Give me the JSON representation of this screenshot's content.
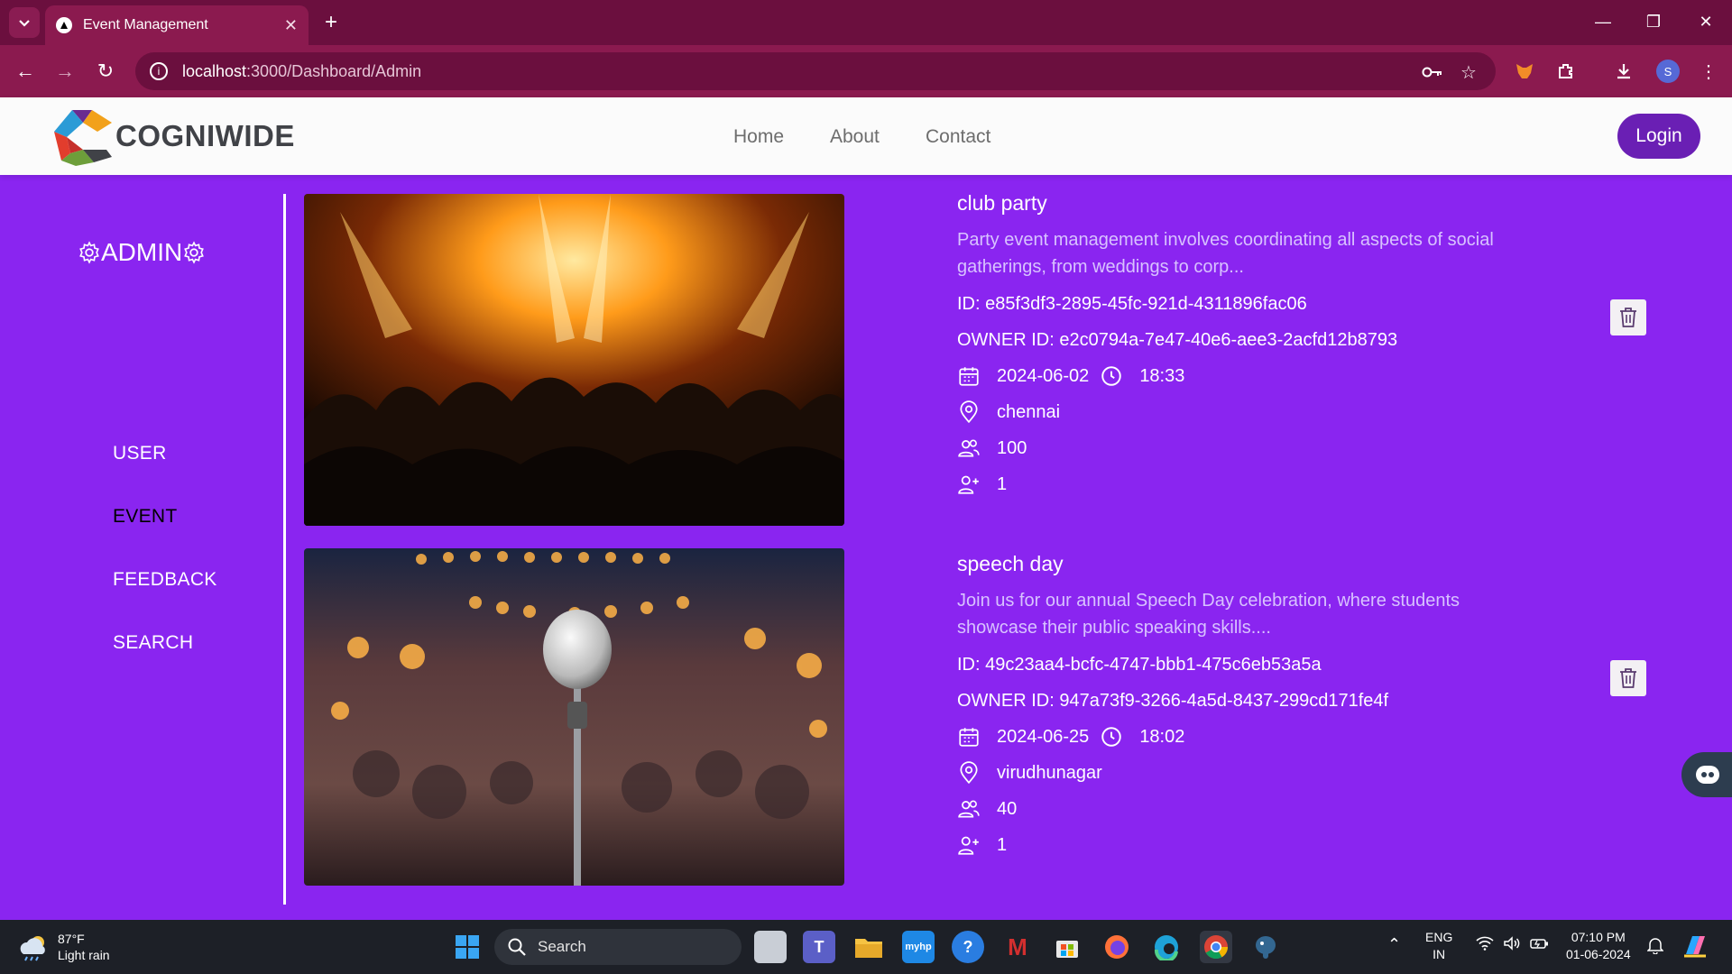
{
  "browser": {
    "tab_title": "Event Management",
    "url_host": "localhost",
    "url_path": ":3000/Dashboard/Admin",
    "profile_initial": "S"
  },
  "site": {
    "logo_text": "COGNIWIDE",
    "nav": [
      "Home",
      "About",
      "Contact"
    ],
    "login_label": "Login"
  },
  "sidebar": {
    "heading": "ADMIN",
    "items": [
      {
        "label": "USER",
        "active": false
      },
      {
        "label": "EVENT",
        "active": true
      },
      {
        "label": "FEEDBACK",
        "active": false
      },
      {
        "label": "SEARCH",
        "active": false
      }
    ]
  },
  "events": [
    {
      "title": "club party",
      "description": "Party event management involves coordinating all aspects of social gatherings, from weddings to corp...",
      "id_line": "ID: e85f3df3-2895-45fc-921d-4311896fac06",
      "owner_line": "OWNER ID: e2c0794a-7e47-40e6-aee3-2acfd12b8793",
      "date": "2024-06-02",
      "time": "18:33",
      "location": "chennai",
      "capacity": "100",
      "registered": "1"
    },
    {
      "title": "speech day",
      "description": "Join us for our annual Speech Day celebration, where students showcase their public speaking skills....",
      "id_line": "ID: 49c23aa4-bcfc-4747-bbb1-475c6eb53a5a",
      "owner_line": "OWNER ID: 947a73f9-3266-4a5d-8437-299cd171fe4f",
      "date": "2024-06-25",
      "time": "18:02",
      "location": "virudhunagar",
      "capacity": "40",
      "registered": "1"
    }
  ],
  "taskbar": {
    "weather_temp": "87°F",
    "weather_text": "Light rain",
    "search_label": "Search",
    "lang_top": "ENG",
    "lang_bottom": "IN",
    "clock_time": "07:10 PM",
    "clock_date": "01-06-2024"
  },
  "colors": {
    "page_bg": "#8a25f0",
    "login_button": "#6a1fb4",
    "browser_frame": "#8b1a4f"
  }
}
